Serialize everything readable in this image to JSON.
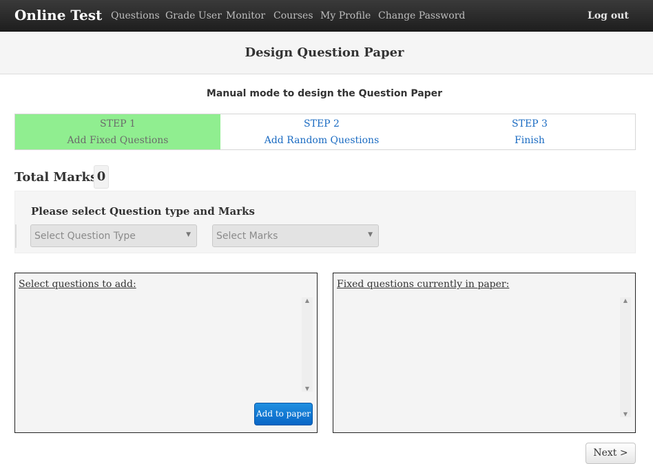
{
  "navbar": {
    "brand": "Online Test",
    "items": [
      "Questions",
      "Grade User",
      "Monitor",
      "Courses",
      "My Profile",
      "Change Password"
    ],
    "logout": "Log out"
  },
  "page": {
    "title": "Design Question Paper",
    "subtitle": "Manual mode to design the Question Paper"
  },
  "steps": [
    {
      "number": "STEP 1",
      "label": "Add Fixed Questions",
      "state": "active"
    },
    {
      "number": "STEP 2",
      "label": "Add Random Questions",
      "state": "link"
    },
    {
      "number": "STEP 3",
      "label": "Finish",
      "state": "link"
    }
  ],
  "total_marks": {
    "label": "Total Marks:",
    "value": "0"
  },
  "question_filter": {
    "prompt": "Please select Question type and Marks",
    "type_select": "Select Question Type",
    "marks_select": "Select Marks"
  },
  "select_box": {
    "label": "Select questions to add:",
    "add_button": "Add to paper"
  },
  "fixed_box": {
    "label": "Fixed questions currently in paper:"
  },
  "next_button": "Next >",
  "icons": {
    "dropdown": "chevron-down-icon",
    "scroll_up": "scroll-up-arrow-icon",
    "scroll_down": "scroll-down-arrow-icon"
  },
  "colors": {
    "active_step": "#90ee90",
    "link": "#1a6bc2",
    "primary_button": "#0a6fd0",
    "navbar": "#2a2a2a"
  }
}
